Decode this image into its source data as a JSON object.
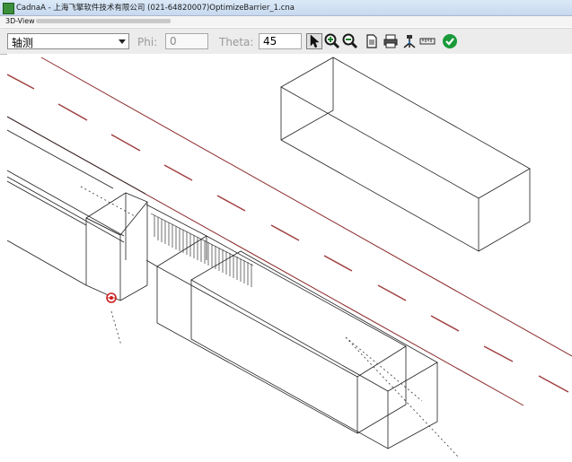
{
  "window": {
    "title": "CadnaA - 上海飞擎软件技术有限公司 (021-64820007)OptimizeBarrier_1.cna"
  },
  "menu": {
    "item_label": "3D-View"
  },
  "toolbar": {
    "view_mode": "轴测",
    "phi_label": "Phi:",
    "phi_value": "0",
    "theta_label": "Theta:",
    "theta_value": "45"
  },
  "icons": [
    "pointer-icon",
    "zoom-in-icon",
    "zoom-out-icon",
    "document-icon",
    "print-icon",
    "tripod-icon",
    "ruler-icon",
    "checkmark-icon"
  ],
  "colors": {
    "road_line": "#8b2a2a",
    "wireframe": "#222222",
    "receiver": "#cc2222",
    "confirm": "#1a9a3a"
  }
}
